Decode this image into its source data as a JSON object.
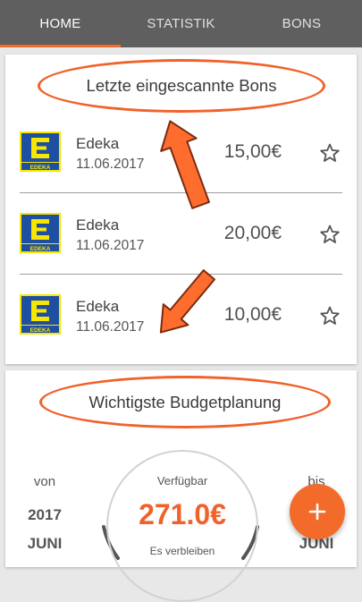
{
  "tabs": [
    {
      "label": "HOME"
    },
    {
      "label": "STATISTIK"
    },
    {
      "label": "BONS"
    }
  ],
  "section1": {
    "title": "Letzte eingescannte Bons"
  },
  "receipts": [
    {
      "store": "Edeka",
      "date": "11.06.2017",
      "amount": "15,00€",
      "logo_text": "EDEKA",
      "logo_icon": "edeka-logo"
    },
    {
      "store": "Edeka",
      "date": "11.06.2017",
      "amount": "20,00€",
      "logo_text": "EDEKA",
      "logo_icon": "edeka-logo"
    },
    {
      "store": "Edeka",
      "date": "11.06.2017",
      "amount": "10,00€",
      "logo_text": "EDEKA",
      "logo_icon": "edeka-logo"
    }
  ],
  "section2": {
    "title": "Wichtigste Budgetplanung"
  },
  "budget": {
    "from_label": "von",
    "from_year": "2017",
    "from_month": "JUNI",
    "to_label": "bis",
    "to_month": "JUNI",
    "available_label": "Verfügbar",
    "available_amount": "271.0€",
    "remaining_label": "Es verbleiben"
  },
  "fab": {
    "label": "+",
    "icon": "plus-icon"
  },
  "colors": {
    "accent": "#f26b2a",
    "tabbar": "#5f5f5f",
    "edeka_blue": "#1f4fa3",
    "edeka_yellow": "#f6e600"
  }
}
